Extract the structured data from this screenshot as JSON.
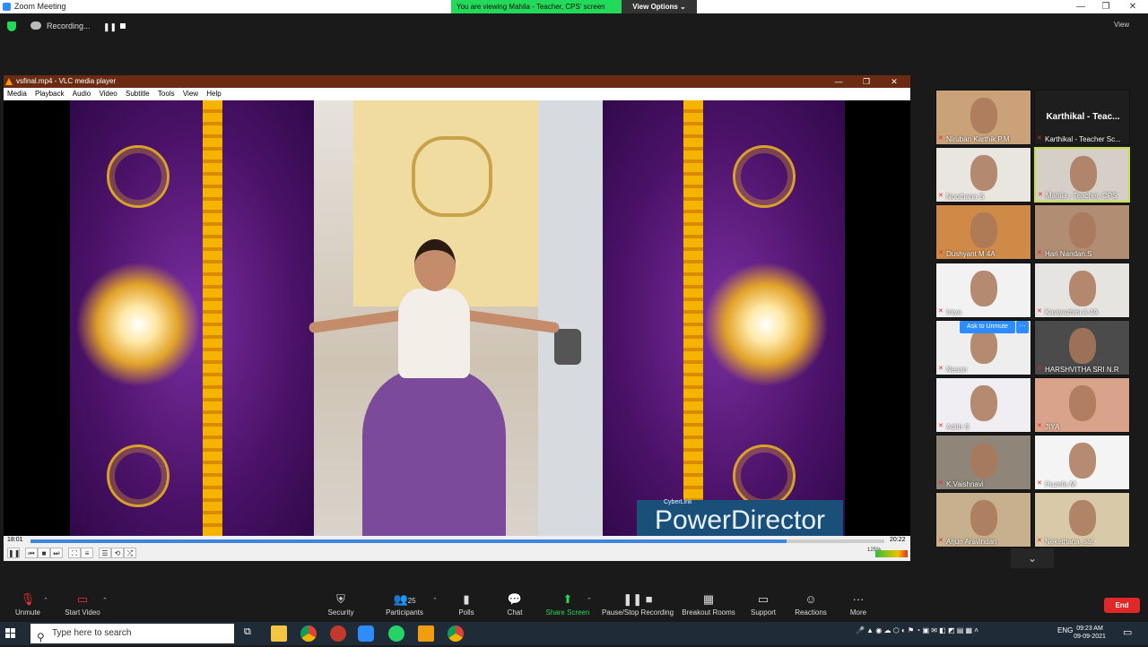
{
  "window": {
    "title": "Zoom Meeting",
    "minimize": "—",
    "maximize": "❐",
    "close": "✕"
  },
  "share_banner": {
    "text": "You are viewing Mahila - Teacher, CPS' screen",
    "view_options": "View Options ⌄"
  },
  "top": {
    "recording": "Recording...",
    "pause": "❚❚",
    "view": "View"
  },
  "vlc": {
    "title": "vsfinal.mp4 - VLC media player",
    "menu": [
      "Media",
      "Playback",
      "Audio",
      "Video",
      "Subtitle",
      "Tools",
      "View",
      "Help"
    ],
    "watermark_brand": "CyberLink",
    "watermark": "PowerDirector",
    "time_elapsed": "18:01",
    "time_total": "20:22",
    "progress": 0.885,
    "volume": "125%"
  },
  "gallery": [
    {
      "name": "Niruban Karthik.P.M",
      "bg": "#c9a27a"
    },
    {
      "name": "Karthikal - Teacher Sc...",
      "big": "Karthikal - Teac...",
      "bg": "#1e1e1e"
    },
    {
      "name": "Noothana S",
      "bg": "#e9e6e0"
    },
    {
      "name": "Mahila - Teacher, CPS",
      "bg": "#d5cfc8",
      "active": true
    },
    {
      "name": "Dushyant M 4A",
      "bg": "#cf8a48"
    },
    {
      "name": "Hari Nandan.S",
      "bg": "#b08d73"
    },
    {
      "name": "Iniya",
      "bg": "#f2f2f2"
    },
    {
      "name": "Kaviyazhini A 4A",
      "bg": "#e6e4e1"
    },
    {
      "name": "Nesan",
      "bg": "#eeeeee"
    },
    {
      "name": "HARSHVITHA SRI N.R",
      "bg": "#4b4b4b"
    },
    {
      "name": "Adith S",
      "bg": "#f0eef2"
    },
    {
      "name": "JIYA",
      "bg": "#d9a28a"
    },
    {
      "name": "K.Vaishnavi",
      "bg": "#8f8578"
    },
    {
      "name": "Huzefa M",
      "bg": "#f4f4f4"
    },
    {
      "name": "Arjun Aravindan",
      "bg": "#c7b08d"
    },
    {
      "name": "Nekethana_sai",
      "bg": "#d8c9a8"
    }
  ],
  "ask_to_unmute": "Ask to Unmute",
  "ask_more": "···",
  "toolbar": {
    "unmute": "Unmute",
    "start_video": "Start Video",
    "security": "Security",
    "participants": "Participants",
    "participants_count": "25",
    "polls": "Polls",
    "chat": "Chat",
    "share_screen": "Share Screen",
    "pause_stop_recording": "Pause/Stop Recording",
    "breakout_rooms": "Breakout Rooms",
    "support": "Support",
    "reactions": "Reactions",
    "more": "More",
    "end": "End"
  },
  "taskbar": {
    "search_placeholder": "Type here to search",
    "language": "ENG",
    "time": "09:23 AM",
    "date": "09-09-2021"
  },
  "colors": {
    "zoom_green": "#23d959",
    "zoom_blue": "#2d8cff",
    "end_red": "#e02828",
    "vlc_title": "#6b2b12"
  }
}
